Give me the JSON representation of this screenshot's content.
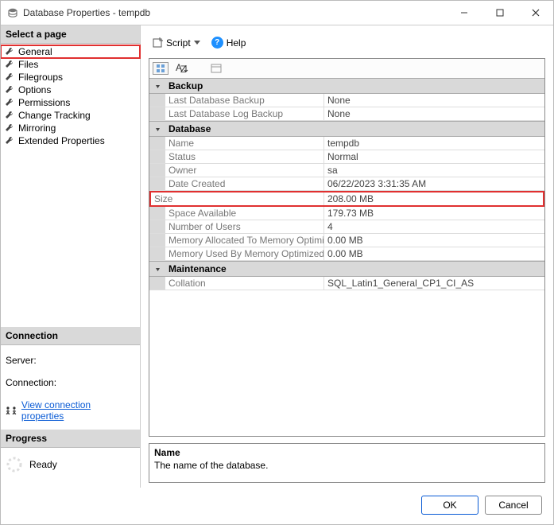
{
  "window": {
    "title": "Database Properties - tempdb"
  },
  "left": {
    "select_page_header": "Select a page",
    "pages": [
      {
        "label": "General",
        "selected": true
      },
      {
        "label": "Files"
      },
      {
        "label": "Filegroups"
      },
      {
        "label": "Options"
      },
      {
        "label": "Permissions"
      },
      {
        "label": "Change Tracking"
      },
      {
        "label": "Mirroring"
      },
      {
        "label": "Extended Properties"
      }
    ],
    "connection_header": "Connection",
    "server_label": "Server:",
    "connection_label": "Connection:",
    "view_conn_props": "View connection properties",
    "progress_header": "Progress",
    "progress_status": "Ready"
  },
  "toolbar": {
    "script": "Script",
    "help": "Help"
  },
  "grid": {
    "categories": [
      {
        "name": "Backup",
        "rows": [
          {
            "label": "Last Database Backup",
            "value": "None"
          },
          {
            "label": "Last Database Log Backup",
            "value": "None"
          }
        ]
      },
      {
        "name": "Database",
        "rows": [
          {
            "label": "Name",
            "value": "tempdb"
          },
          {
            "label": "Status",
            "value": "Normal"
          },
          {
            "label": "Owner",
            "value": "sa"
          },
          {
            "label": "Date Created",
            "value": "06/22/2023 3:31:35 AM"
          },
          {
            "label": "Size",
            "value": "208.00 MB",
            "highlight": true
          },
          {
            "label": "Space Available",
            "value": "179.73 MB"
          },
          {
            "label": "Number of Users",
            "value": "4"
          },
          {
            "label": "Memory Allocated To Memory Optimized Obje",
            "value": "0.00 MB"
          },
          {
            "label": "Memory Used By Memory Optimized Objects",
            "value": "0.00 MB"
          }
        ]
      },
      {
        "name": "Maintenance",
        "rows": [
          {
            "label": "Collation",
            "value": "SQL_Latin1_General_CP1_CI_AS"
          }
        ]
      }
    ]
  },
  "desc": {
    "title": "Name",
    "text": "The name of the database."
  },
  "buttons": {
    "ok": "OK",
    "cancel": "Cancel"
  }
}
